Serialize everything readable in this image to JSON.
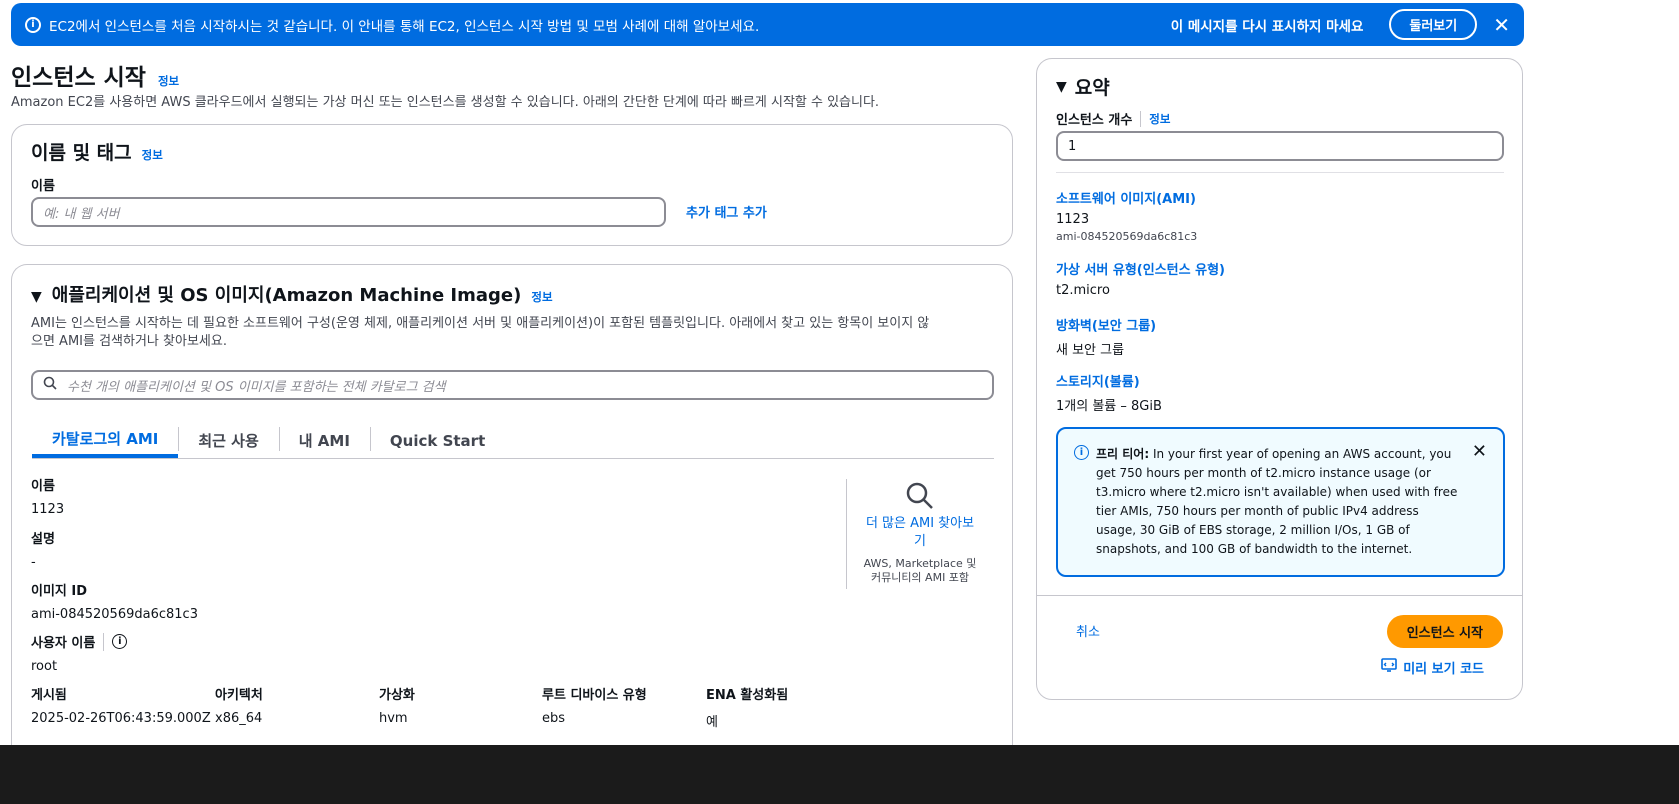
{
  "banner": {
    "message": "EC2에서 인스턴스를 처음 시작하시는 것 같습니다. 이 안내를 통해 EC2, 인스턴스 시작 방법 및 모범 사례에 대해 알아보세요.",
    "dont_show": "이 메시지를 다시 표시하지 마세요",
    "tour": "둘러보기"
  },
  "page": {
    "title": "인스턴스 시작",
    "info": "정보",
    "description": "Amazon EC2를 사용하면 AWS 클라우드에서 실행되는 가상 머신 또는 인스턴스를 생성할 수 있습니다. 아래의 간단한 단계에 따라 빠르게 시작할 수 있습니다."
  },
  "name_tags": {
    "title": "이름 및 태그",
    "info": "정보",
    "name_label": "이름",
    "name_placeholder": "예: 내 웹 서버",
    "add_tags": "추가 태그 추가"
  },
  "ami": {
    "title": "애플리케이션 및 OS 이미지(Amazon Machine Image)",
    "info": "정보",
    "description_line1": "AMI는 인스턴스를 시작하는 데 필요한 소프트웨어 구성(운영 체제, 애플리케이션 서버 및 애플리케이션)이 포함된 템플릿입니다. 아래에서 찾고 있는 항목이 보이지 않",
    "description_line2": "으면 AMI를 검색하거나 찾아보세요.",
    "search_placeholder": "수천 개의 애플리케이션 및 OS 이미지를 포함하는 전체 카탈로그 검색",
    "tabs": [
      {
        "label": "카탈로그의 AMI"
      },
      {
        "label": "최근 사용"
      },
      {
        "label": "내 AMI"
      },
      {
        "label": "Quick Start"
      }
    ],
    "details": {
      "name_label": "이름",
      "name_value": "1123",
      "desc_label": "설명",
      "desc_value": "-",
      "image_id_label": "이미지 ID",
      "image_id_value": "ami-084520569da6c81c3",
      "owner_label": "사용자 이름",
      "owner_value": "root"
    },
    "columns": [
      {
        "label": "게시됨",
        "value": "2025-02-26T06:43:59.000Z"
      },
      {
        "label": "아키텍처",
        "value": "x86_64"
      },
      {
        "label": "가상화",
        "value": "hvm"
      },
      {
        "label": "루트 디바이스 유형",
        "value": "ebs"
      },
      {
        "label": "ENA 활성화됨",
        "value": "예"
      }
    ],
    "browse_more_line1": "더 많은 AMI 찾아보",
    "browse_more_line2": "기",
    "browse_sub_line1": "AWS, Marketplace 및",
    "browse_sub_line2": "커뮤니티의 AMI 포함"
  },
  "summary": {
    "title": "요약",
    "instance_count_label": "인스턴스 개수",
    "info": "정보",
    "instance_count": "1",
    "software_image_label": "소프트웨어 이미지(AMI)",
    "software_image_name": "1123",
    "software_image_id": "ami-084520569da6c81c3",
    "instance_type_label": "가상 서버 유형(인스턴스 유형)",
    "instance_type_value": "t2.micro",
    "firewall_label": "방화벽(보안 그룹)",
    "firewall_value": "새 보안 그룹",
    "storage_label": "스토리지(볼륨)",
    "storage_value": "1개의 볼륨 – 8GiB",
    "free_tier_title": "프리 티어:",
    "free_tier_lines": [
      "In your first year of opening an AWS account, you",
      "get 750 hours per month of t2.micro instance usage (or",
      "t3.micro where t2.micro isn't available) when used with free",
      "tier AMIs, 750 hours per month of public IPv4 address",
      "usage, 30 GiB of EBS storage, 2 million I/Os, 1 GB of",
      "snapshots, and 100 GB of bandwidth to the internet."
    ],
    "cancel": "취소",
    "launch": "인스턴스 시작",
    "preview_code": "미리 보기 코드"
  },
  "colors": {
    "primary": "#006ce0",
    "launch_button": "#ff9900",
    "border": "#c6c6cd",
    "free_tier_bg": "#f0fbff"
  }
}
